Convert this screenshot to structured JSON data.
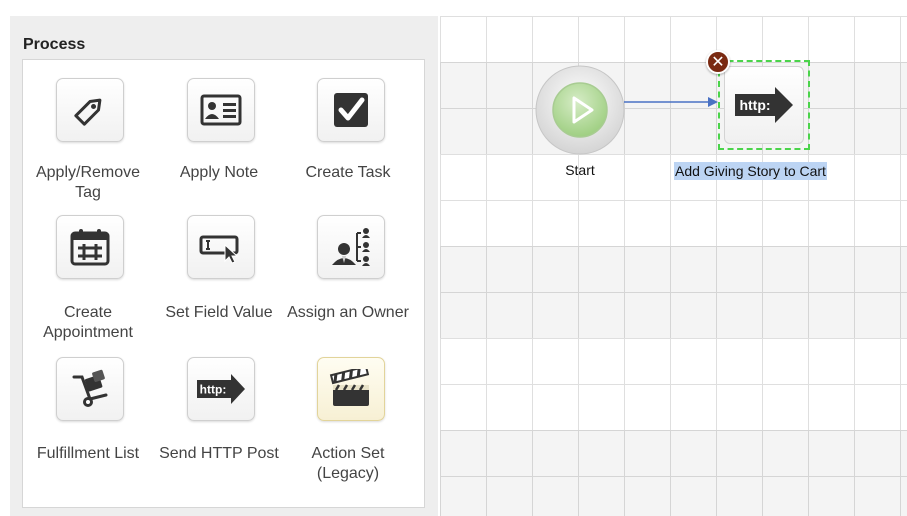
{
  "palette": {
    "title": "Process",
    "actions": [
      {
        "label": "Apply/Remove Tag",
        "icon": "tag-icon"
      },
      {
        "label": "Apply Note",
        "icon": "note-card-icon"
      },
      {
        "label": "Create Task",
        "icon": "checkbox-icon"
      },
      {
        "label": "Create Appointment",
        "icon": "calendar-icon"
      },
      {
        "label": "Set Field Value",
        "icon": "field-cursor-icon"
      },
      {
        "label": "Assign an Owner",
        "icon": "owner-org-icon"
      },
      {
        "label": "Fulfillment List",
        "icon": "hand-truck-icon"
      },
      {
        "label": "Send HTTP Post",
        "icon": "http-arrow-icon"
      },
      {
        "label": "Action Set (Legacy)",
        "icon": "clapperboard-icon"
      }
    ]
  },
  "canvas": {
    "start_node": {
      "label": "Start",
      "icon": "play-icon"
    },
    "selected_node": {
      "label": "Add Giving Story to Cart",
      "icon_text": "http:",
      "delete_symbol": "✕"
    }
  },
  "colors": {
    "selection_border": "#4bd44b",
    "label_highlight": "#bcd4f3",
    "connector": "#4a72c4",
    "delete_button": "#7a2a12",
    "start_play": "#a6d48a"
  }
}
